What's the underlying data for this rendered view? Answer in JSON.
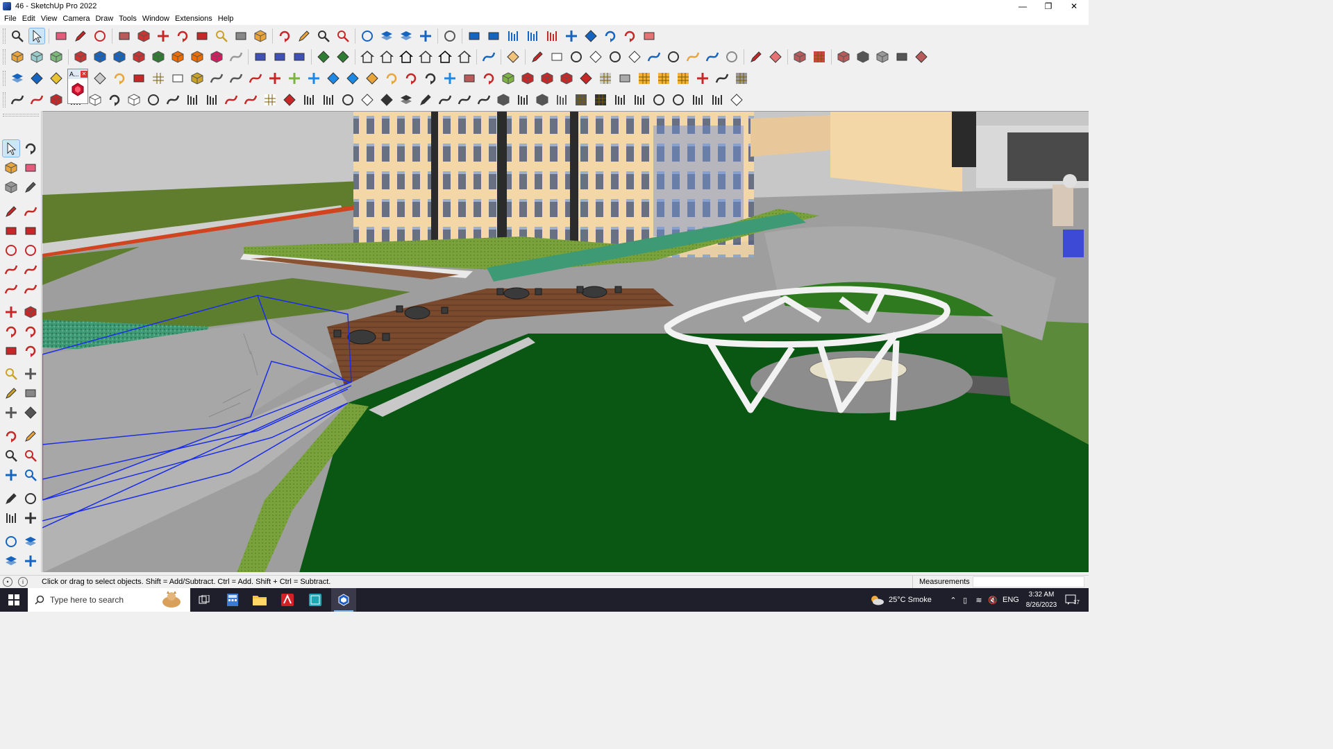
{
  "window": {
    "title": "46 - SketchUp Pro 2022"
  },
  "menu": [
    "File",
    "Edit",
    "View",
    "Camera",
    "Draw",
    "Tools",
    "Window",
    "Extensions",
    "Help"
  ],
  "floating_tag": "A...",
  "status": {
    "message": "Click or drag to select objects. Shift = Add/Subtract. Ctrl = Add. Shift + Ctrl = Subtract.",
    "measurements_label": "Measurements",
    "measurements_value": ""
  },
  "taskbar": {
    "search_placeholder": "Type here to search",
    "weather": "25°C  Smoke",
    "language": "ENG",
    "time": "3:32 AM",
    "date": "8/26/2023",
    "notifications_count": "17"
  },
  "colors": {
    "selection": "#1a2de8",
    "building": "#f4d7a6",
    "lawn": "#0a5714",
    "deck": "#7a4a2e",
    "taskbar": "#1f1f2b"
  }
}
